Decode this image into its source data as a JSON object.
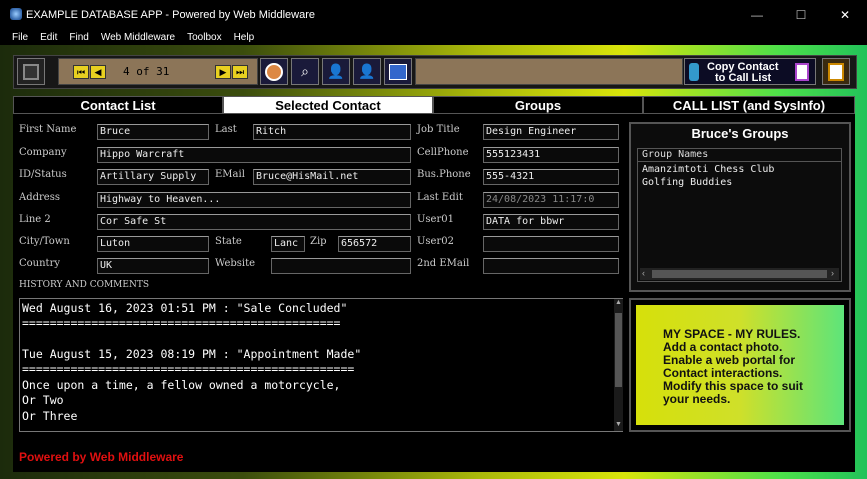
{
  "window": {
    "title": "EXAMPLE DATABASE APP - Powered by Web Middleware",
    "minimize": "—",
    "maximize": "☐",
    "close": "✕"
  },
  "menu": [
    "File",
    "Edit",
    "Find",
    "Web Middleware",
    "Toolbox",
    "Help"
  ],
  "toolbar": {
    "record_counter": "4 of 31",
    "copy_button": {
      "line1": "Copy Contact",
      "line2": "to Call List"
    }
  },
  "tabs": [
    "Contact List",
    "Selected Contact",
    "Groups",
    "CALL LIST (and SysInfo)"
  ],
  "labels": {
    "first_name": "First Name",
    "last": "Last",
    "job_title": "Job Title",
    "company": "Company",
    "cellphone": "CellPhone",
    "id_status": "ID/Status",
    "email": "EMail",
    "bus_phone": "Bus.Phone",
    "address": "Address",
    "last_edit": "Last Edit",
    "line2": "Line 2",
    "user01": "User01",
    "city_town": "City/Town",
    "state": "State",
    "zip": "Zip",
    "user02": "User02",
    "country": "Country",
    "website": "Website",
    "second_email": "2nd EMail",
    "history": "HISTORY AND COMMENTS"
  },
  "contact": {
    "first_name": "Bruce",
    "last": "Ritch",
    "job_title": "Design Engineer",
    "company": "Hippo Warcraft",
    "cellphone": "555123431",
    "id_status": "Artillary Supply",
    "email": "Bruce@HisMail.net",
    "bus_phone": "555-4321",
    "address": "Highway to Heaven...",
    "last_edit": "24/08/2023 11:17:0",
    "line2": "Cor Safe St",
    "user01": "DATA for bbwr",
    "city_town": "Luton",
    "state": "Lanc",
    "zip": "656572",
    "user02": "",
    "country": "UK",
    "website": "",
    "second_email": ""
  },
  "groups": {
    "title": "Bruce's Groups",
    "column": "Group Names",
    "items": [
      "Amanzimtoti Chess Club",
      "Golfing Buddies"
    ]
  },
  "comments": [
    "Wed August 16, 2023 01:51 PM : \"Sale Concluded\"",
    "==============================================",
    "",
    "Tue August 15, 2023 08:19 PM : \"Appointment Made\"",
    "================================================",
    "Once upon a time, a fellow owned a motorcycle,",
    "Or Two",
    "Or Three"
  ],
  "myspace": [
    "MY SPACE - MY RULES.",
    "Add a contact photo.",
    "Enable a web portal for",
    "Contact interactions.",
    "Modify this space to suit",
    "your needs."
  ],
  "footer": "Powered by Web Middleware"
}
